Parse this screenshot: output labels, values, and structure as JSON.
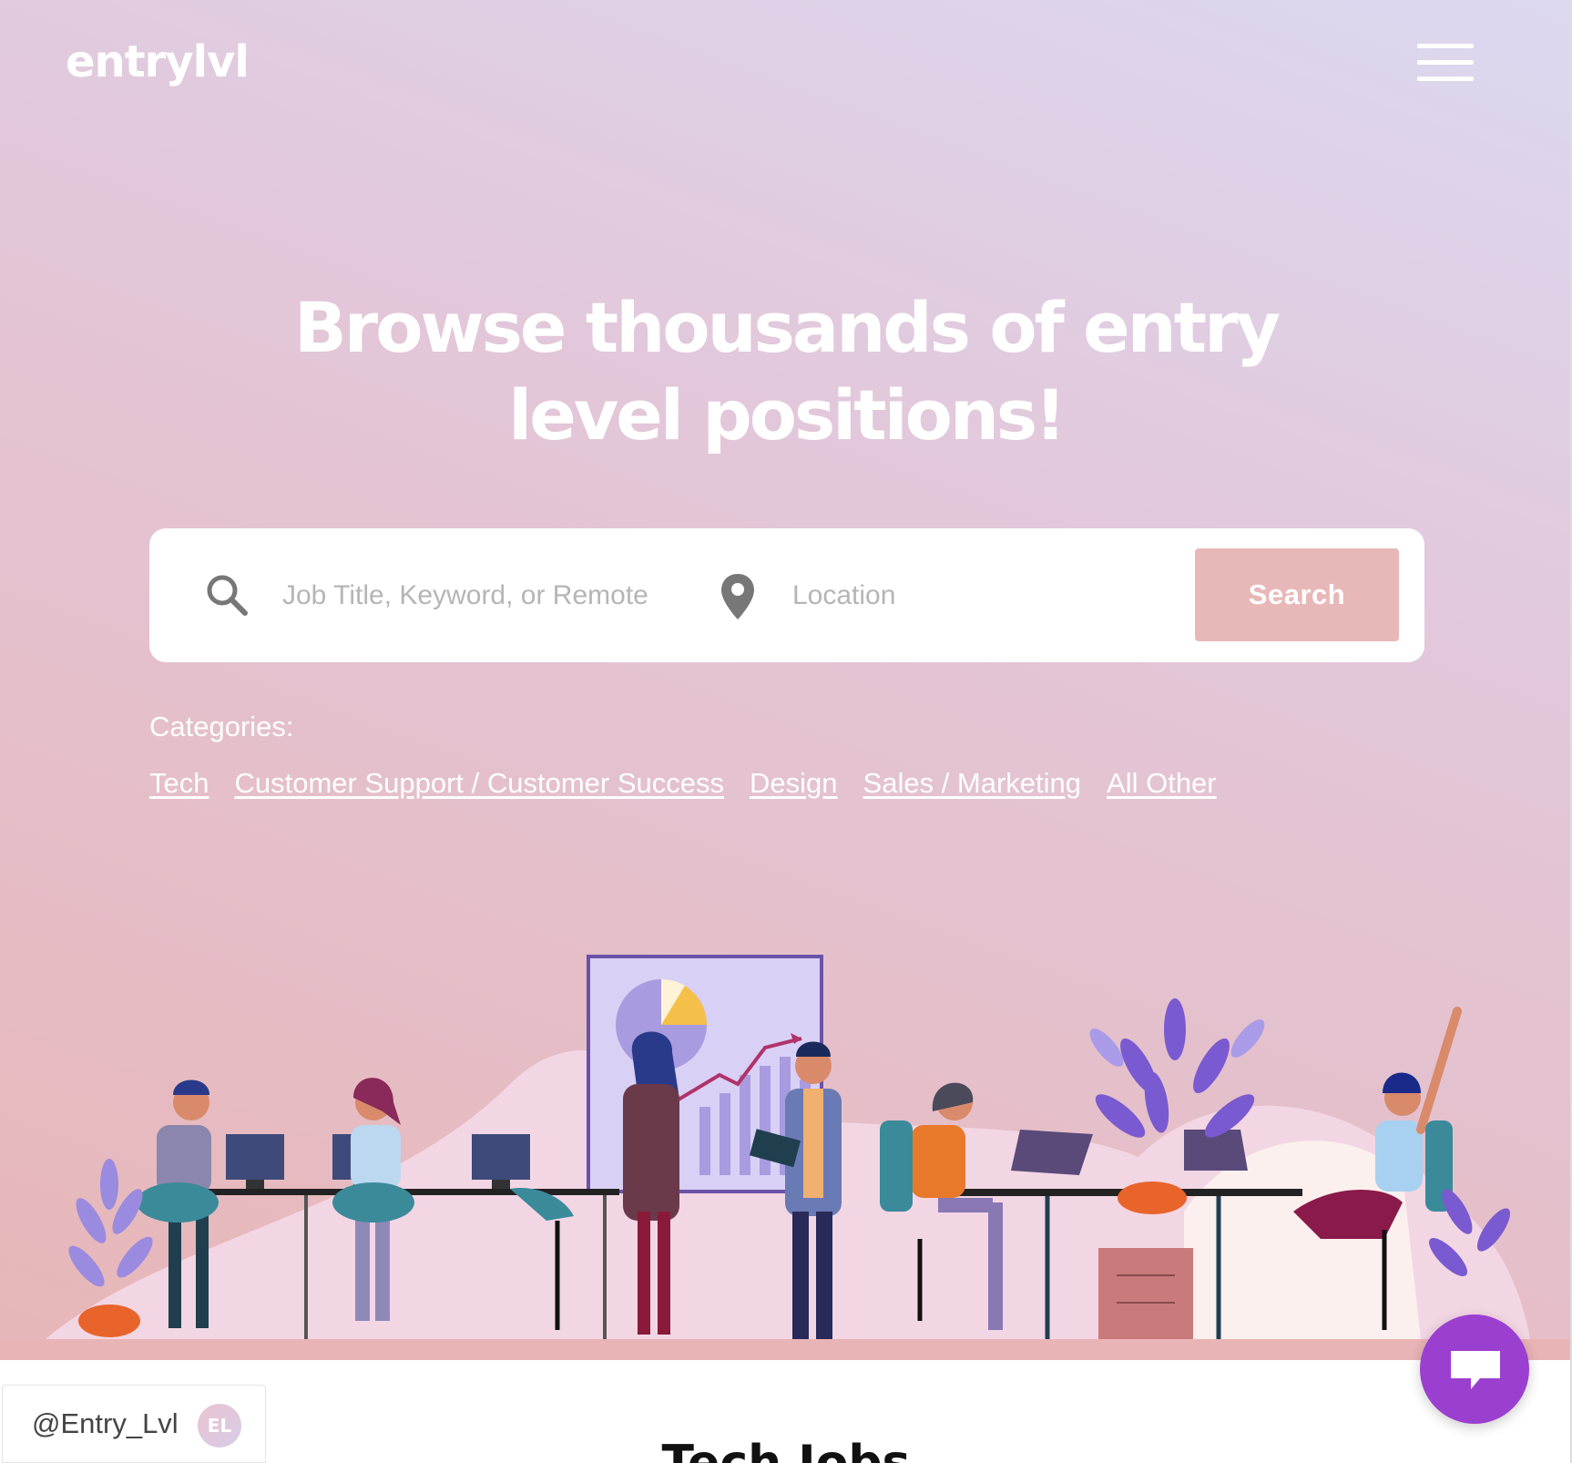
{
  "brand": {
    "logo_text": "entrylvl"
  },
  "header": {
    "menu_icon": "hamburger-menu-icon"
  },
  "hero": {
    "headline_line1": "Browse thousands of entry",
    "headline_line2": "level positions!"
  },
  "search": {
    "keyword_placeholder": "Job Title, Keyword, or Remote",
    "location_placeholder": "Location",
    "button_label": "Search",
    "keyword_icon": "search-icon",
    "location_icon": "map-pin-icon"
  },
  "categories": {
    "label": "Categories:",
    "items": [
      {
        "label": "Tech"
      },
      {
        "label": "Customer Support / Customer Success"
      },
      {
        "label": "Design"
      },
      {
        "label": "Sales / Marketing"
      },
      {
        "label": "All Other"
      }
    ]
  },
  "twitter": {
    "handle": "@Entry_Lvl",
    "avatar_initials": "EL"
  },
  "section": {
    "heading": "Tech Jobs"
  },
  "chat": {
    "icon": "chat-bubble-icon"
  },
  "colors": {
    "search_button": "#e8b8b8",
    "chat_button": "#9b3fd0",
    "hero_gradient_start": "#e7b6b7",
    "hero_gradient_end": "#dcd8f0"
  }
}
